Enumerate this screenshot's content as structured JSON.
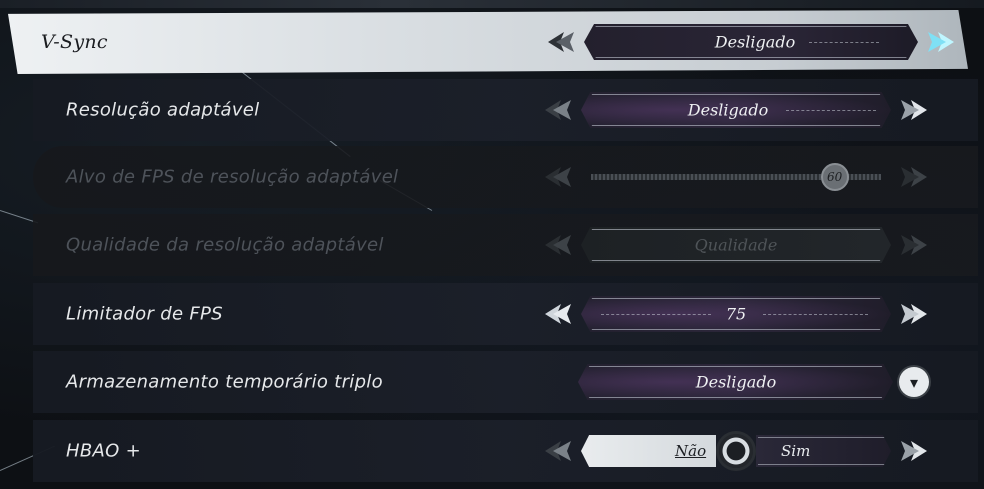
{
  "settings": [
    {
      "label": "V-Sync",
      "value": "Desligado",
      "type": "selector",
      "state": "selected"
    },
    {
      "label": "Resolução adaptável",
      "value": "Desligado",
      "type": "selector",
      "state": "normal"
    },
    {
      "label": "Alvo de FPS de resolução adaptável",
      "value": "60",
      "type": "slider",
      "state": "disabled",
      "level": 0.84
    },
    {
      "label": "Qualidade da resolução adaptável",
      "value": "Qualidade",
      "type": "selector",
      "state": "disabled"
    },
    {
      "label": "Limitador de FPS",
      "value": "75",
      "type": "selector",
      "state": "normal"
    },
    {
      "label": "Armazenamento temporário triplo",
      "value": "Desligado",
      "type": "dropdown",
      "state": "normal"
    },
    {
      "label": "HBAO +",
      "type": "toggle",
      "state": "normal",
      "off_label": "Não",
      "on_label": "Sim",
      "selected": "Não"
    }
  ],
  "icons": {
    "left": "arrow-left-icon",
    "right": "arrow-right-icon",
    "dropdown": "chevron-down-icon",
    "toggle_knob": "gear-icon"
  },
  "colors": {
    "highlight": "#aef1ff",
    "selected_row": "#e2e6e9",
    "text": "#e6e8ea",
    "disabled": "#4e535a"
  }
}
